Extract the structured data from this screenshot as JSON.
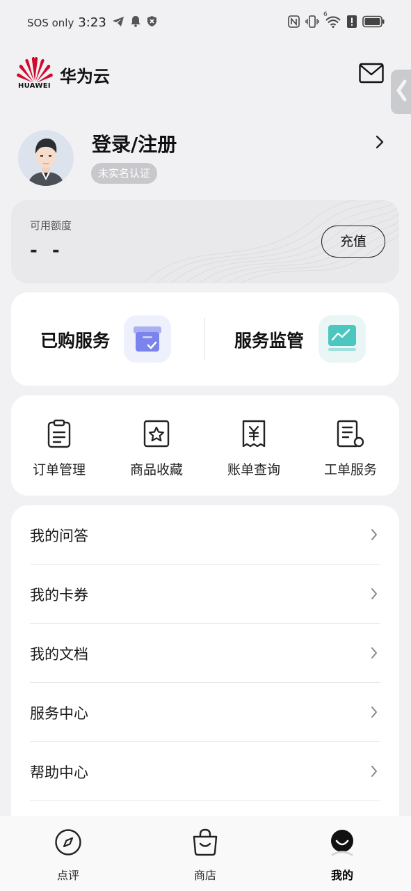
{
  "status_bar": {
    "carrier": "SOS only",
    "time": "3:23",
    "network_badge": "6"
  },
  "header": {
    "logo_text": "HUAWEI",
    "app_title": "华为云"
  },
  "profile": {
    "login_label": "登录/注册",
    "realname_badge": "未实名认证"
  },
  "balance": {
    "label": "可用额度",
    "value": "- -",
    "recharge_label": "充值"
  },
  "services": {
    "purchased_label": "已购服务",
    "monitor_label": "服务监管"
  },
  "actions": [
    {
      "label": "订单管理",
      "icon": "clipboard-icon"
    },
    {
      "label": "商品收藏",
      "icon": "star-box-icon"
    },
    {
      "label": "账单查询",
      "icon": "yen-receipt-icon"
    },
    {
      "label": "工单服务",
      "icon": "ticket-document-icon"
    }
  ],
  "menu": [
    {
      "label": "我的问答"
    },
    {
      "label": "我的卡券"
    },
    {
      "label": "我的文档"
    },
    {
      "label": "服务中心"
    },
    {
      "label": "帮助中心"
    }
  ],
  "bottom_nav": [
    {
      "label": "点评",
      "icon": "compass-icon",
      "active": false
    },
    {
      "label": "商店",
      "icon": "shopping-bag-icon",
      "active": false
    },
    {
      "label": "我的",
      "icon": "profile-smile-icon",
      "active": true
    }
  ],
  "colors": {
    "brand_red": "#cf0a2c",
    "background": "#f1f1f3",
    "card": "#ffffff",
    "badge_gray": "#c8c8cc",
    "purchased_icon": "#7b83ec",
    "monitor_icon": "#4cc7c0"
  }
}
